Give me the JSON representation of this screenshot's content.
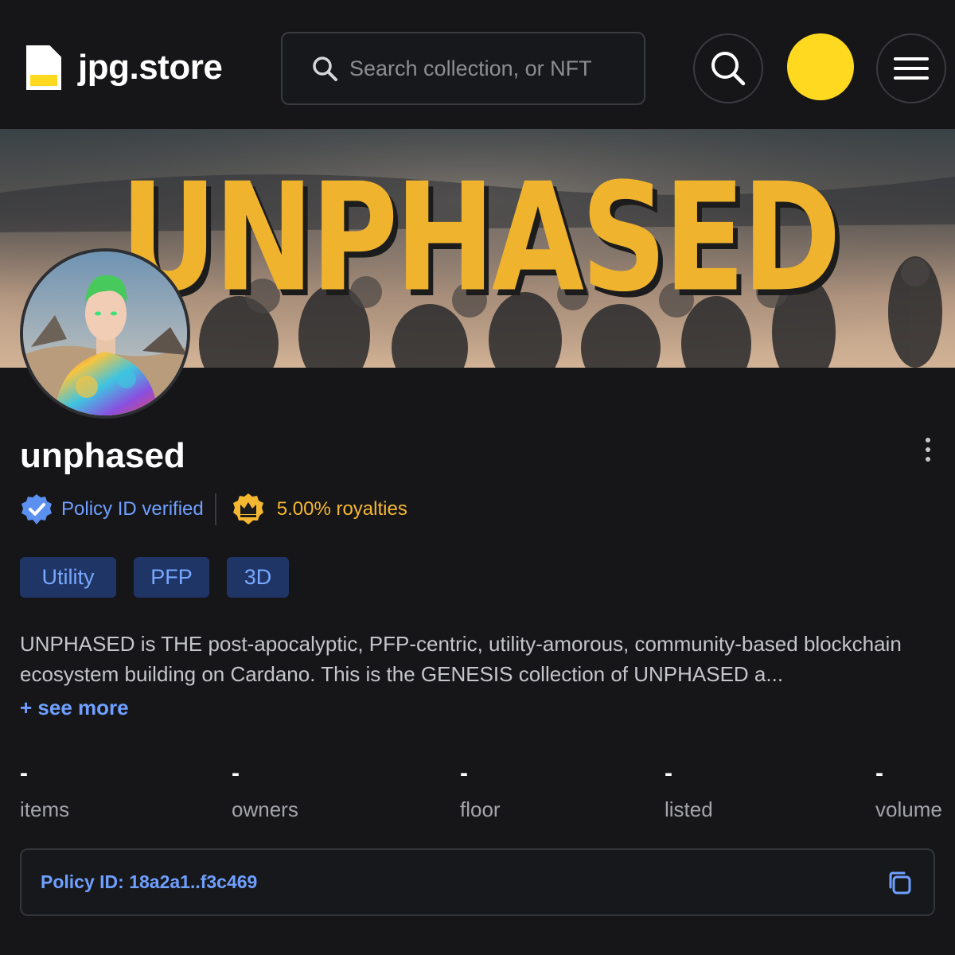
{
  "header": {
    "logo_text": "jpg.store",
    "search_placeholder": "Search collection, or NFT",
    "icons": [
      "file-logo-icon",
      "search-icon",
      "menu-icon"
    ],
    "brand_color": "#ffd91f"
  },
  "banner": {
    "title": "UNPHASED",
    "title_color": "#f0b32e"
  },
  "collection": {
    "name": "unphased",
    "verified_label": "Policy ID verified",
    "royalties_label": "5.00% royalties",
    "tags": [
      "Utility",
      "PFP",
      "3D"
    ],
    "description": "UNPHASED is THE post-apocalyptic, PFP-centric, utility-amorous, community-based blockchain ecosystem building on Cardano. This is the GENESIS collection of UNPHASED a...",
    "see_more_label": "+ see more"
  },
  "stats": [
    {
      "value": "-",
      "label": "items"
    },
    {
      "value": "-",
      "label": "owners"
    },
    {
      "value": "-",
      "label": "floor"
    },
    {
      "value": "-",
      "label": "listed"
    },
    {
      "value": "-",
      "label": "volume"
    }
  ],
  "policy": {
    "text": "Policy ID: 18a2a1..f3c469"
  },
  "colors": {
    "background": "#161618",
    "link_blue": "#6fa0ff",
    "tag_bg": "#1f3566",
    "royalty_gold": "#f5b731"
  }
}
